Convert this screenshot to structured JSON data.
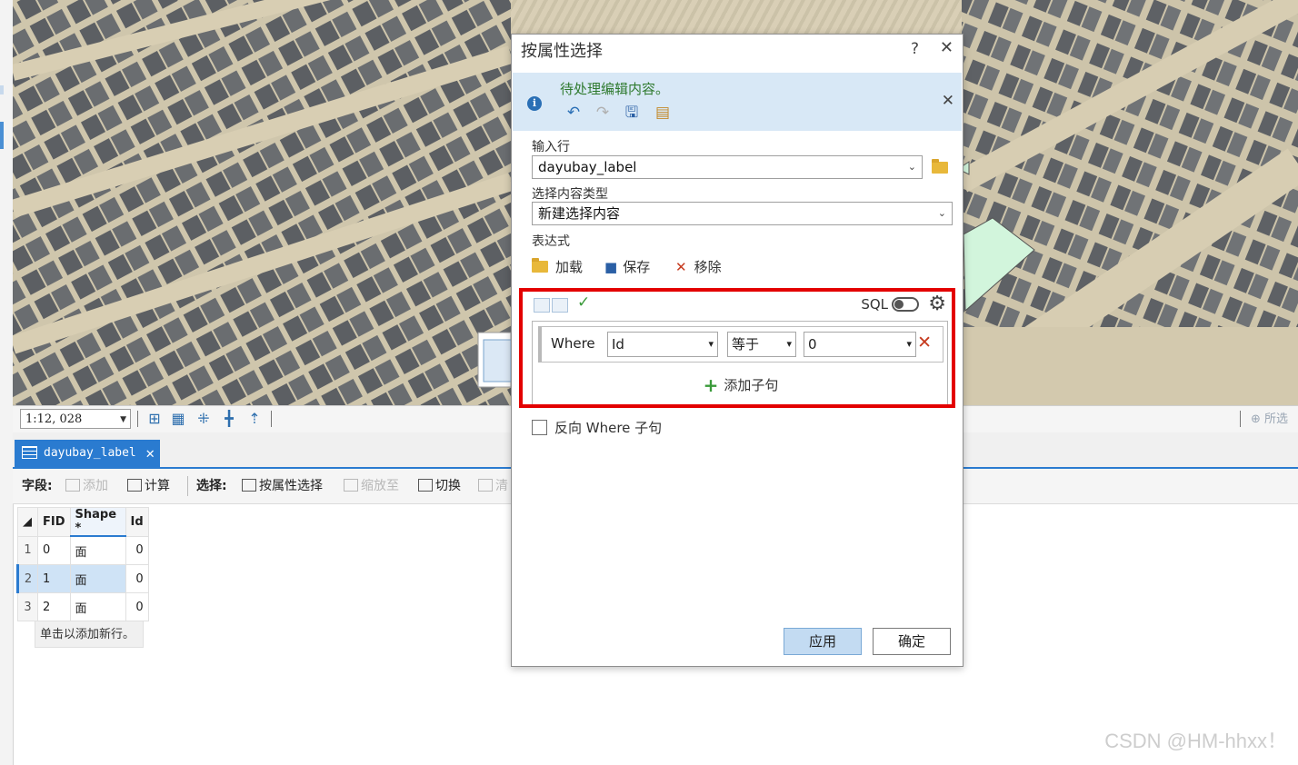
{
  "map": {
    "scale": "1:12, 028",
    "right_tool_label": "所选"
  },
  "attribute_table": {
    "tab_label": "dayubay_label",
    "tab_close": "✕",
    "toolbar": {
      "field_label": "字段:",
      "add_label": "添加",
      "calculate_label": "计算",
      "select_label": "选择:",
      "select_by_attr_label": "按属性选择",
      "zoom_to_label": "缩放至",
      "switch_label": "切换",
      "clear_label": "清"
    },
    "columns": [
      "FID",
      "Shape *",
      "Id"
    ],
    "rows": [
      {
        "row_num": "1",
        "fid": "0",
        "shape": "面",
        "id": "0"
      },
      {
        "row_num": "2",
        "fid": "1",
        "shape": "面",
        "id": "0"
      },
      {
        "row_num": "3",
        "fid": "2",
        "shape": "面",
        "id": "0"
      }
    ],
    "add_row_text": "单击以添加新行。"
  },
  "dialog": {
    "title": "按属性选择",
    "help": "?",
    "close": "✕",
    "info": {
      "message": "待处理编辑内容。",
      "close": "✕"
    },
    "input_rows_label": "输入行",
    "input_rows_value": "dayubay_label",
    "selection_type_label": "选择内容类型",
    "selection_type_value": "新建选择内容",
    "expression_label": "表达式",
    "load_label": "加载",
    "save_label": "保存",
    "remove_label": "移除",
    "sql_label": "SQL",
    "clause": {
      "where": "Where",
      "field": "Id",
      "operator": "等于",
      "value": "0"
    },
    "add_clause_label": "添加子句",
    "invert_label": "反向 Where 子句",
    "apply_label": "应用",
    "ok_label": "确定"
  },
  "watermark": "CSDN @HM-hhxx！"
}
